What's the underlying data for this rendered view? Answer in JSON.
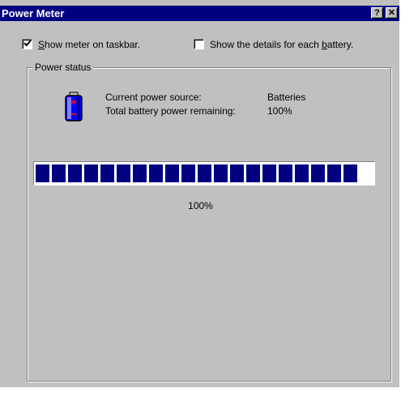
{
  "window": {
    "title": "Power Meter",
    "help_label": "?",
    "close_label": "✕"
  },
  "options": {
    "show_meter": {
      "label_accel": "S",
      "label_rest": "how meter on taskbar.",
      "checked": true
    },
    "show_details": {
      "label_pre": "Show the details for each ",
      "label_accel": "b",
      "label_rest": "attery.",
      "checked": false
    }
  },
  "power_status": {
    "group_label": "Power status",
    "icon": "battery-icon",
    "source_label": "Current power source:",
    "source_value": "Batteries",
    "remaining_label": "Total battery power remaining:",
    "remaining_value": "100%"
  },
  "meter": {
    "level": 1.0,
    "percent_text": "100%",
    "fill_color": "#000080"
  }
}
